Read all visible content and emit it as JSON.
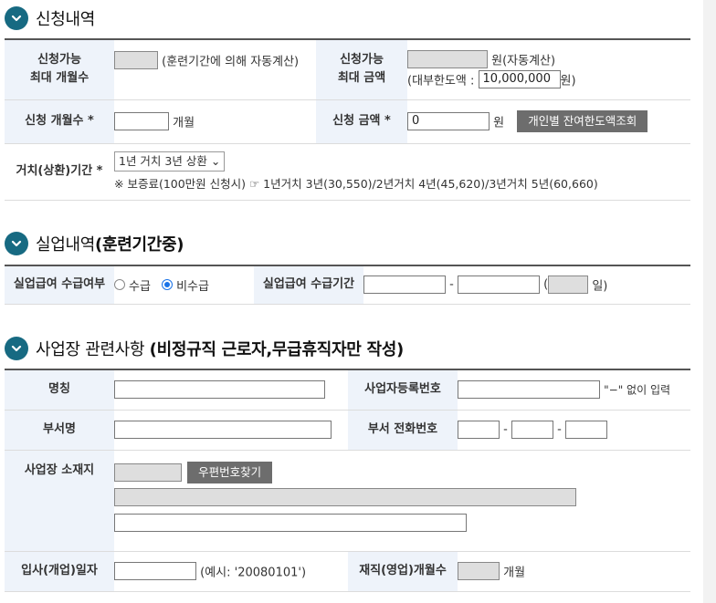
{
  "sections": {
    "application": {
      "title": "신청내역"
    },
    "unemployment": {
      "title_plain": "실업내역",
      "title_bold": "(훈련기간중)"
    },
    "workplace": {
      "title_plain": "사업장 관련사항 ",
      "title_bold": "(비정규직 근로자,무급휴직자만 작성)"
    }
  },
  "application": {
    "max_months_label_1": "신청가능",
    "max_months_label_2": "최대 개월수",
    "max_months_note": "(훈련기간에 의해 자동계산)",
    "max_amount_label_1": "신청가능",
    "max_amount_label_2": "최대 금액",
    "max_amount_unit": "원(자동계산)",
    "limit_prefix": "(대부한도액 :",
    "limit_value": "10,000,000",
    "limit_suffix": "원)",
    "months_label": "신청 개월수 *",
    "months_unit": "개월",
    "amount_label": "신청 금액 *",
    "amount_value": "0",
    "amount_unit": "원",
    "balance_button": "개인별 잔여한도액조회",
    "grace_label": "거치(상환)기간 *",
    "grace_selected": "1년 거치 3년 상환",
    "grace_note": "※ 보증료(100만원 신청시) ☞ 1년거치 3년(30,550)/2년거치 4년(45,620)/3년거치 5년(60,660)"
  },
  "unemployment": {
    "benefit_label": "실업급여 수급여부",
    "opt_receive": "수급",
    "opt_not_receive": "비수급",
    "period_label": "실업급여 수급기간",
    "dash": "-",
    "open_paren": "(",
    "days_unit": "일)"
  },
  "workplace": {
    "name_label": "명칭",
    "reg_no_label": "사업자등록번호",
    "reg_no_note": "\"−\" 없이 입력",
    "dept_label": "부서명",
    "dept_phone_label": "부서 전화번호",
    "dash": "-",
    "address_label": "사업장 소재지",
    "zip_button": "우편번호찾기",
    "hire_date_label": "입사(개업)일자",
    "hire_date_example": "(예시: '20080101')",
    "tenure_label": "재직(영업)개월수",
    "tenure_unit": "개월"
  },
  "colors": {
    "accent": "#176a82",
    "label_bg": "#eef3fa",
    "button_bg": "#6d6d6d",
    "radio_on": "#1a73e8"
  }
}
